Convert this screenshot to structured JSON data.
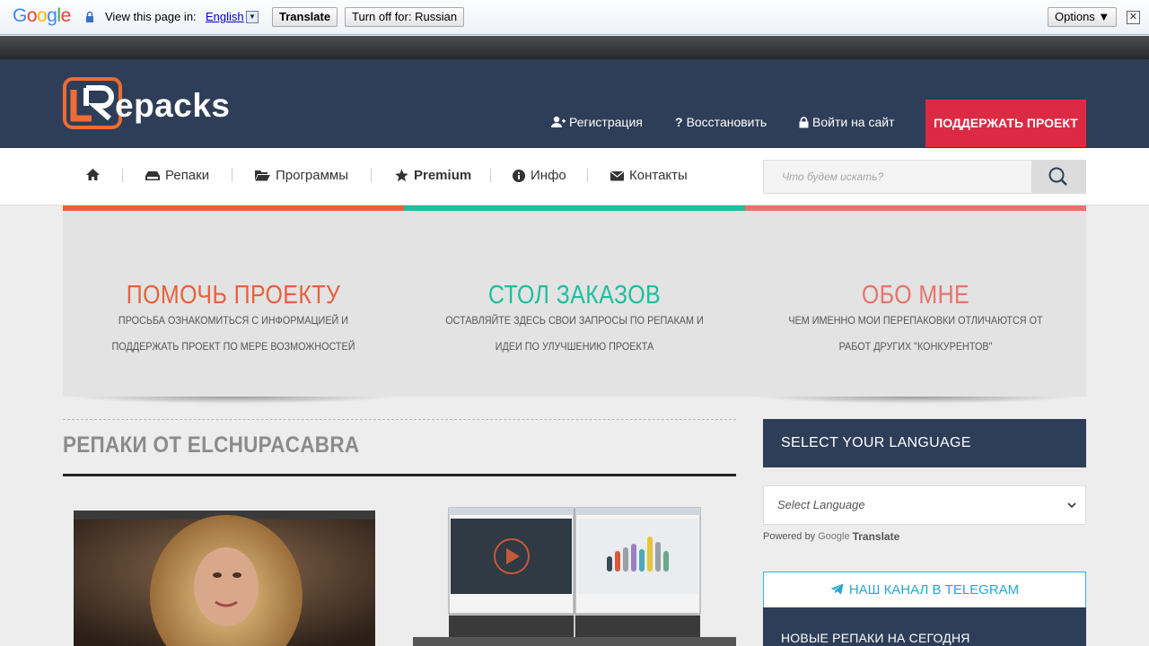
{
  "translate_bar": {
    "logo": "Google",
    "prompt": "View this page in:",
    "language": "English",
    "translate_btn": "Translate",
    "turn_off_btn": "Turn off for: Russian",
    "options_btn": "Options ▼",
    "close": "✕"
  },
  "header": {
    "logo_text": "epacks",
    "links": [
      "Регистрация",
      "Восстановить",
      "Войти на сайт"
    ],
    "support_btn": "ПОДДЕРЖАТЬ ПРОЕКТ"
  },
  "nav": {
    "items": [
      "Репаки",
      "Программы",
      "Premium",
      "Инфо",
      "Контакты"
    ],
    "search_placeholder": "Что будем искать?"
  },
  "features": [
    {
      "title": "ПОМОЧЬ ПРОЕКТУ",
      "desc": "ПРОСЬБА ОЗНАКОМИТЬСЯ С ИНФОРМАЦИЕЙ И ПОДДЕРЖАТЬ ПРОЕКТ ПО МЕРЕ ВОЗМОЖНОСТЕЙ",
      "color": "#e8603c"
    },
    {
      "title": "СТОЛ ЗАКАЗОВ",
      "desc": "ОСТАВЛЯЙТЕ ЗДЕСЬ СВОИ ЗАПРОСЫ ПО РЕПАКАМ И ИДЕИ ПО УЛУЧШЕНИЮ ПРОЕКТА",
      "color": "#1dbf9c"
    },
    {
      "title": "ОБО МНЕ",
      "desc": "ЧЕМ ИМЕННО МОИ ПЕРЕПАКОВКИ ОТЛИЧАЮТСЯ ОТ РАБОТ ДРУГИХ \"КОНКУРЕНТОВ\"",
      "color": "#e8736c"
    }
  ],
  "main": {
    "section_title": "РЕПАКИ ОТ ELCHUPACABRA"
  },
  "sidebar": {
    "language_heading": "SELECT YOUR LANGUAGE",
    "select_value": "Select Language",
    "powered_by": "Powered by",
    "google": "Google",
    "translate": "Translate",
    "telegram": "НАШ КАНАЛ В TELEGRAM",
    "new_heading": "НОВЫЕ РЕПАКИ НА СЕГОДНЯ"
  }
}
